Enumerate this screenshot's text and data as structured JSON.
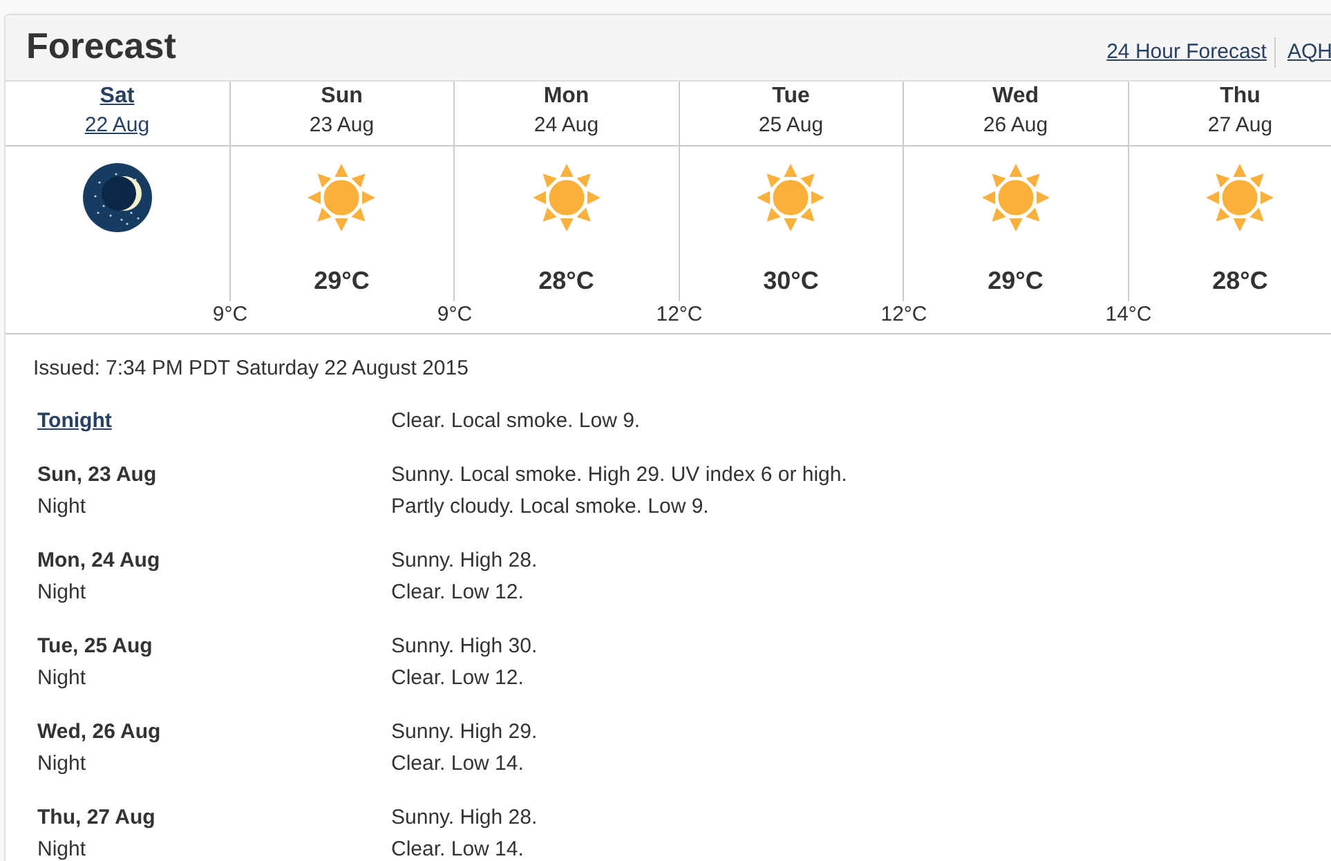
{
  "header": {
    "title": "Forecast",
    "links": [
      "24 Hour Forecast",
      "AQH"
    ]
  },
  "days": [
    {
      "day": "Sat",
      "date": "22 Aug",
      "link": true,
      "kind": "night",
      "low": "9°C"
    },
    {
      "day": "Sun",
      "date": "23 Aug",
      "link": false,
      "kind": "sunny",
      "high": "29°C",
      "low": "9°C"
    },
    {
      "day": "Mon",
      "date": "24 Aug",
      "link": false,
      "kind": "sunny",
      "high": "28°C",
      "low": "12°C"
    },
    {
      "day": "Tue",
      "date": "25 Aug",
      "link": false,
      "kind": "sunny",
      "high": "30°C",
      "low": "12°C"
    },
    {
      "day": "Wed",
      "date": "26 Aug",
      "link": false,
      "kind": "sunny",
      "high": "29°C",
      "low": "14°C"
    },
    {
      "day": "Thu",
      "date": "27 Aug",
      "link": false,
      "kind": "sunny",
      "high": "28°C"
    }
  ],
  "issued": "Issued: 7:34 PM PDT Saturday 22 August 2015",
  "groups": [
    {
      "rows": [
        {
          "kind": "link",
          "label": "Tonight",
          "text": "Clear. Local smoke. Low 9."
        }
      ]
    },
    {
      "rows": [
        {
          "kind": "day",
          "label": "Sun, 23 Aug",
          "text": "Sunny. Local smoke. High 29. UV index 6 or high."
        },
        {
          "kind": "night",
          "label": "Night",
          "text": "Partly cloudy. Local smoke. Low 9."
        }
      ]
    },
    {
      "rows": [
        {
          "kind": "day",
          "label": "Mon, 24 Aug",
          "text": "Sunny. High 28."
        },
        {
          "kind": "night",
          "label": "Night",
          "text": "Clear. Low 12."
        }
      ]
    },
    {
      "rows": [
        {
          "kind": "day",
          "label": "Tue, 25 Aug",
          "text": "Sunny. High 30."
        },
        {
          "kind": "night",
          "label": "Night",
          "text": "Clear. Low 12."
        }
      ]
    },
    {
      "rows": [
        {
          "kind": "day",
          "label": "Wed, 26 Aug",
          "text": "Sunny. High 29."
        },
        {
          "kind": "night",
          "label": "Night",
          "text": "Clear. Low 14."
        }
      ]
    },
    {
      "rows": [
        {
          "kind": "day",
          "label": "Thu, 27 Aug",
          "text": "Sunny. High 28."
        },
        {
          "kind": "night",
          "label": "Night",
          "text": "Clear. Low 14."
        }
      ]
    }
  ]
}
